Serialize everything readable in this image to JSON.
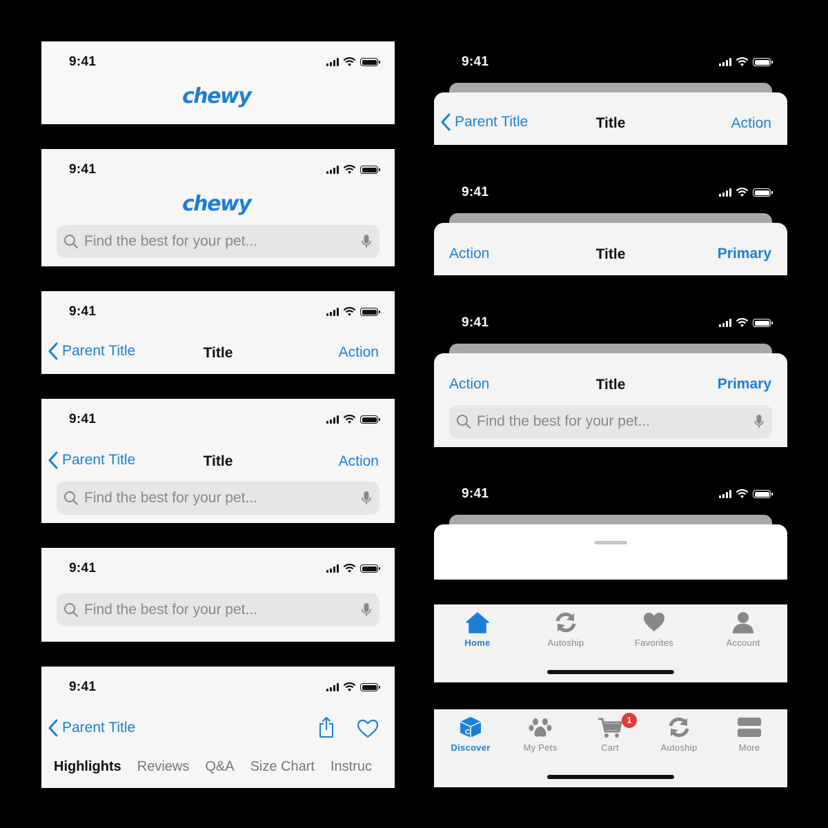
{
  "status_time": "9:41",
  "brand": {
    "logo_text": "chewy",
    "color": "#1c7fd6"
  },
  "search": {
    "placeholder": "Find the best for your pet..."
  },
  "nav": {
    "back_label": "Parent Title",
    "title": "Title",
    "action_label": "Action",
    "primary_label": "Primary"
  },
  "product_tabs": [
    "Highlights",
    "Reviews",
    "Q&A",
    "Size Chart",
    "Instruc"
  ],
  "tabbar_a": {
    "items": [
      {
        "label": "Home",
        "icon": "house-icon",
        "active": true
      },
      {
        "label": "Autoship",
        "icon": "autoship-icon",
        "active": false
      },
      {
        "label": "Favorites",
        "icon": "heart-icon",
        "active": false
      },
      {
        "label": "Account",
        "icon": "person-icon",
        "active": false
      }
    ]
  },
  "tabbar_b": {
    "items": [
      {
        "label": "Discover",
        "icon": "box-icon",
        "active": true
      },
      {
        "label": "My Pets",
        "icon": "paw-icon",
        "active": false
      },
      {
        "label": "Cart",
        "icon": "cart-icon",
        "active": false,
        "badge": "1"
      },
      {
        "label": "Autoship",
        "icon": "autoship-icon",
        "active": false
      },
      {
        "label": "More",
        "icon": "more-icon",
        "active": false
      }
    ]
  },
  "colors": {
    "accent": "#1c7fd6",
    "inactive": "#888888",
    "badge": "#e53935"
  }
}
